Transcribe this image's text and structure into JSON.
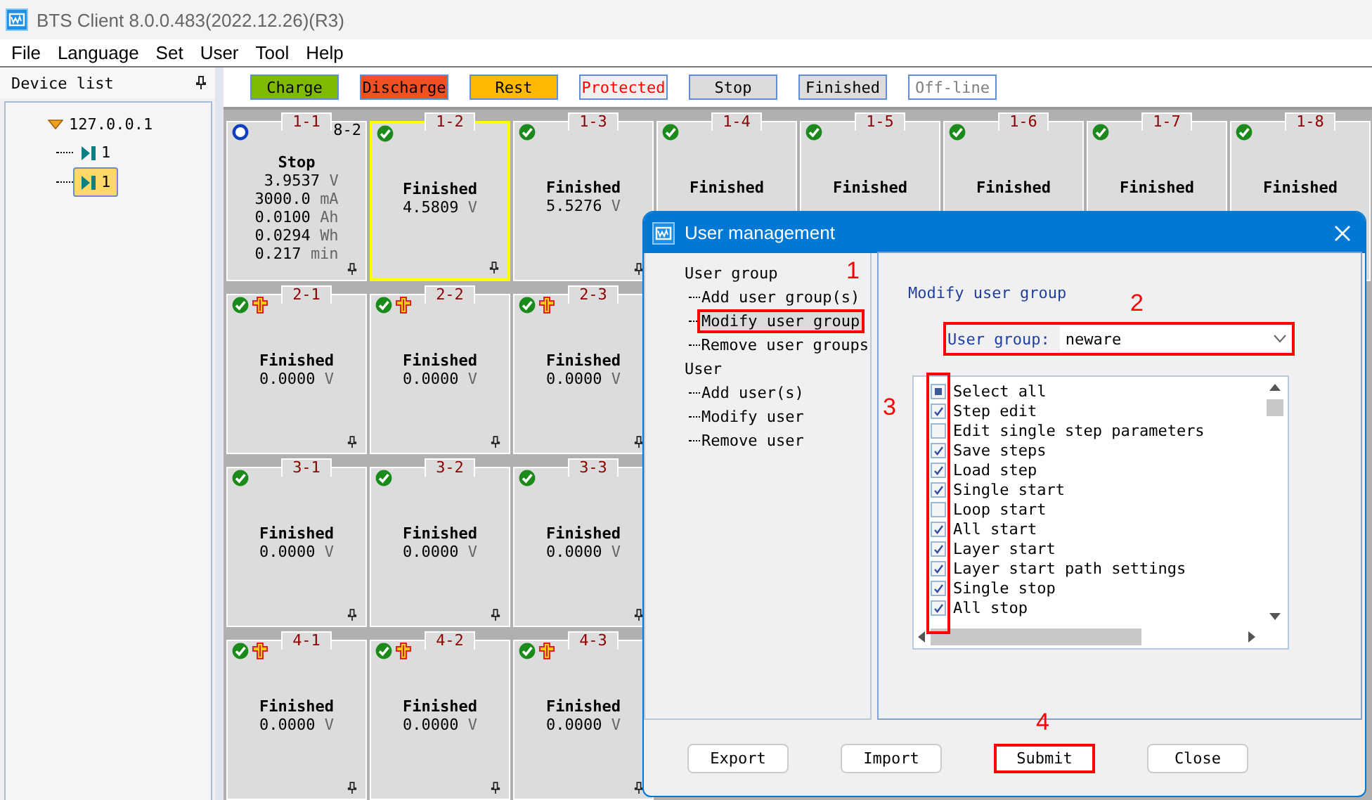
{
  "window": {
    "title": "BTS Client 8.0.0.483(2022.12.26)(R3)"
  },
  "menu": [
    "File",
    "Language",
    "Set",
    "User",
    "Tool",
    "Help"
  ],
  "device_panel": {
    "title": "Device list",
    "tree": [
      {
        "label": "127.0.0.1",
        "expanded": true,
        "children": [
          {
            "label": "1",
            "selected": false
          },
          {
            "label": "1",
            "selected": true
          }
        ]
      }
    ]
  },
  "legend": [
    {
      "label": "Charge",
      "color": "#7fba00",
      "kind": "plain"
    },
    {
      "label": "Discharge",
      "color": "#f25022",
      "kind": "plain"
    },
    {
      "label": "Rest",
      "color": "#ffb900",
      "kind": "plain"
    },
    {
      "label": "Protected",
      "color": "#f0f0f0",
      "kind": "alert"
    },
    {
      "label": "Stop",
      "color": "#dcdcdc",
      "kind": "plain"
    },
    {
      "label": "Finished",
      "color": "#dcdcdc",
      "kind": "plain"
    },
    {
      "label": "Off-line",
      "color": "#ffffff",
      "kind": "muted"
    }
  ],
  "channel_rows": [
    [
      {
        "label": "1-1",
        "icons": [
          {
            "kind": "ring"
          }
        ],
        "corner": "8-2",
        "status": "Stop",
        "selected": false,
        "lines": [
          {
            "value": "3.9537",
            "unit": "V"
          },
          {
            "value": "3000.0",
            "unit": "mA"
          },
          {
            "value": "0.0100",
            "unit": "Ah"
          },
          {
            "value": "0.0294",
            "unit": "Wh"
          },
          {
            "value": "0.217",
            "unit": "min"
          }
        ]
      },
      {
        "label": "1-2",
        "icons": [
          {
            "kind": "check"
          }
        ],
        "status": "Finished",
        "selected": true,
        "lines": [
          {
            "value": "4.5809",
            "unit": "V"
          }
        ]
      },
      {
        "label": "1-3",
        "icons": [
          {
            "kind": "check"
          }
        ],
        "status": "Finished",
        "selected": false,
        "lines": [
          {
            "value": "5.5276",
            "unit": "V"
          }
        ]
      },
      {
        "label": "1-4",
        "icons": [
          {
            "kind": "check"
          }
        ],
        "status": "Finished",
        "selected": false
      },
      {
        "label": "1-5",
        "icons": [
          {
            "kind": "check"
          }
        ],
        "status": "Finished",
        "selected": false
      },
      {
        "label": "1-6",
        "icons": [
          {
            "kind": "check"
          }
        ],
        "status": "Finished",
        "selected": false
      },
      {
        "label": "1-7",
        "icons": [
          {
            "kind": "check"
          }
        ],
        "status": "Finished",
        "selected": false
      },
      {
        "label": "1-8",
        "icons": [
          {
            "kind": "check"
          }
        ],
        "status": "Finished",
        "selected": false
      }
    ],
    [
      {
        "label": "2-1",
        "icons": [
          {
            "kind": "check"
          },
          {
            "kind": "plug"
          }
        ],
        "status": "Finished",
        "selected": false,
        "lines": [
          {
            "value": "0.0000",
            "unit": "V"
          }
        ]
      },
      {
        "label": "2-2",
        "icons": [
          {
            "kind": "check"
          },
          {
            "kind": "plug"
          }
        ],
        "status": "Finished",
        "selected": false,
        "lines": [
          {
            "value": "0.0000",
            "unit": "V"
          }
        ]
      },
      {
        "label": "2-3",
        "icons": [
          {
            "kind": "check"
          },
          {
            "kind": "plug"
          }
        ],
        "status": "Finished",
        "selected": false,
        "lines": [
          {
            "value": "0.0000",
            "unit": "V"
          }
        ]
      }
    ],
    [
      {
        "label": "3-1",
        "icons": [
          {
            "kind": "check"
          }
        ],
        "status": "Finished",
        "selected": false,
        "lines": [
          {
            "value": "0.0000",
            "unit": "V"
          }
        ]
      },
      {
        "label": "3-2",
        "icons": [
          {
            "kind": "check"
          }
        ],
        "status": "Finished",
        "selected": false,
        "lines": [
          {
            "value": "0.0000",
            "unit": "V"
          }
        ]
      },
      {
        "label": "3-3",
        "icons": [
          {
            "kind": "check"
          }
        ],
        "status": "Finished",
        "selected": false,
        "lines": [
          {
            "value": "0.0000",
            "unit": "V"
          }
        ]
      }
    ],
    [
      {
        "label": "4-1",
        "icons": [
          {
            "kind": "check"
          },
          {
            "kind": "plug"
          }
        ],
        "status": "Finished",
        "selected": false,
        "lines": [
          {
            "value": "0.0000",
            "unit": "V"
          }
        ]
      },
      {
        "label": "4-2",
        "icons": [
          {
            "kind": "check"
          },
          {
            "kind": "plug"
          }
        ],
        "status": "Finished",
        "selected": false,
        "lines": [
          {
            "value": "0.0000",
            "unit": "V"
          }
        ]
      },
      {
        "label": "4-3",
        "icons": [
          {
            "kind": "check"
          },
          {
            "kind": "plug"
          }
        ],
        "status": "Finished",
        "selected": false,
        "lines": [
          {
            "value": "0.0000",
            "unit": "V"
          }
        ]
      }
    ]
  ],
  "dialog": {
    "title": "User management",
    "tree": [
      {
        "label": "User group",
        "selected": false,
        "children": [
          {
            "label": "Add user group(s)",
            "selected": false
          },
          {
            "label": "Modify user group",
            "selected": true,
            "annotation": "1"
          },
          {
            "label": "Remove user groups",
            "selected": false
          }
        ]
      },
      {
        "label": "User",
        "selected": false,
        "children": [
          {
            "label": "Add user(s)",
            "selected": false
          },
          {
            "label": "Modify user",
            "selected": false
          },
          {
            "label": "Remove user",
            "selected": false
          }
        ]
      }
    ],
    "heading": "Modify user group",
    "group_field": {
      "label": "User group:",
      "value": "neware",
      "annotation": "2"
    },
    "permissions_annotation": "3",
    "permissions": [
      {
        "label": "Select all",
        "checked": false,
        "partial": true
      },
      {
        "label": "Step edit",
        "checked": true
      },
      {
        "label": "Edit single step parameters",
        "checked": false
      },
      {
        "label": "Save steps",
        "checked": true
      },
      {
        "label": "Load step",
        "checked": true
      },
      {
        "label": "Single start",
        "checked": true
      },
      {
        "label": "Loop start",
        "checked": false
      },
      {
        "label": "All start",
        "checked": true
      },
      {
        "label": "Layer start",
        "checked": true
      },
      {
        "label": "Layer start path settings",
        "checked": true
      },
      {
        "label": "Single stop",
        "checked": true
      },
      {
        "label": "All stop",
        "checked": true
      }
    ],
    "buttons": [
      {
        "label": "Export"
      },
      {
        "label": "Import"
      },
      {
        "label": "Submit",
        "annotation": "4"
      },
      {
        "label": "Close"
      }
    ]
  }
}
